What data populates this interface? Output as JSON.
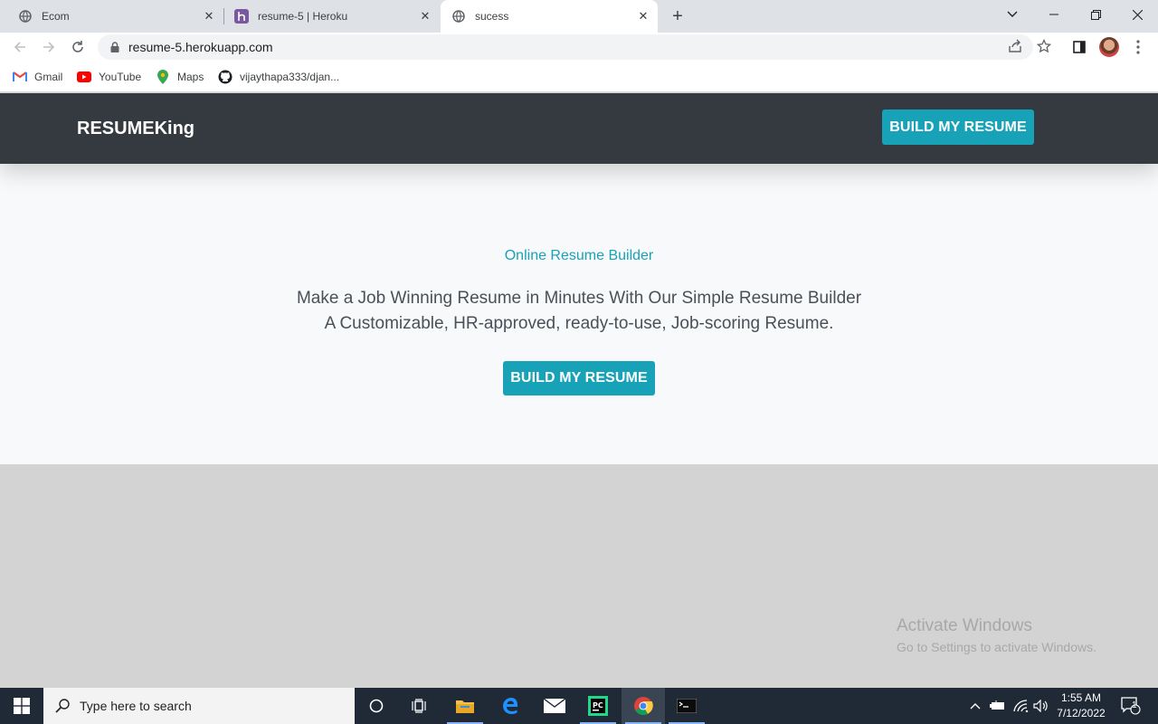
{
  "browser": {
    "tabs": [
      {
        "title": "Ecom",
        "favicon": "globe-icon"
      },
      {
        "title": "resume-5 | Heroku",
        "favicon": "heroku-icon"
      },
      {
        "title": "sucess",
        "favicon": "globe-icon",
        "active": true
      }
    ],
    "url": "resume-5.herokuapp.com",
    "bookmarks": [
      {
        "label": "Gmail",
        "icon": "gmail-icon"
      },
      {
        "label": "YouTube",
        "icon": "youtube-icon"
      },
      {
        "label": "Maps",
        "icon": "maps-icon"
      },
      {
        "label": "vijaythapa333/djan...",
        "icon": "github-icon"
      }
    ]
  },
  "site": {
    "brand": "RESUMEKing",
    "nav_button": "BUILD MY RESUME",
    "hero": {
      "eyebrow": "Online Resume Builder",
      "line1": "Make a Job Winning Resume in Minutes With Our Simple Resume Builder",
      "line2": "A Customizable, HR-approved, ready-to-use, Job-scoring Resume.",
      "cta": "BUILD MY RESUME"
    },
    "accent_color": "#17a2b8",
    "nav_color": "#343a40"
  },
  "watermark": {
    "title": "Activate Windows",
    "subtitle": "Go to Settings to activate Windows."
  },
  "taskbar": {
    "search_placeholder": "Type here to search",
    "time": "1:55 AM",
    "date": "7/12/2022",
    "notification_count": "1"
  }
}
